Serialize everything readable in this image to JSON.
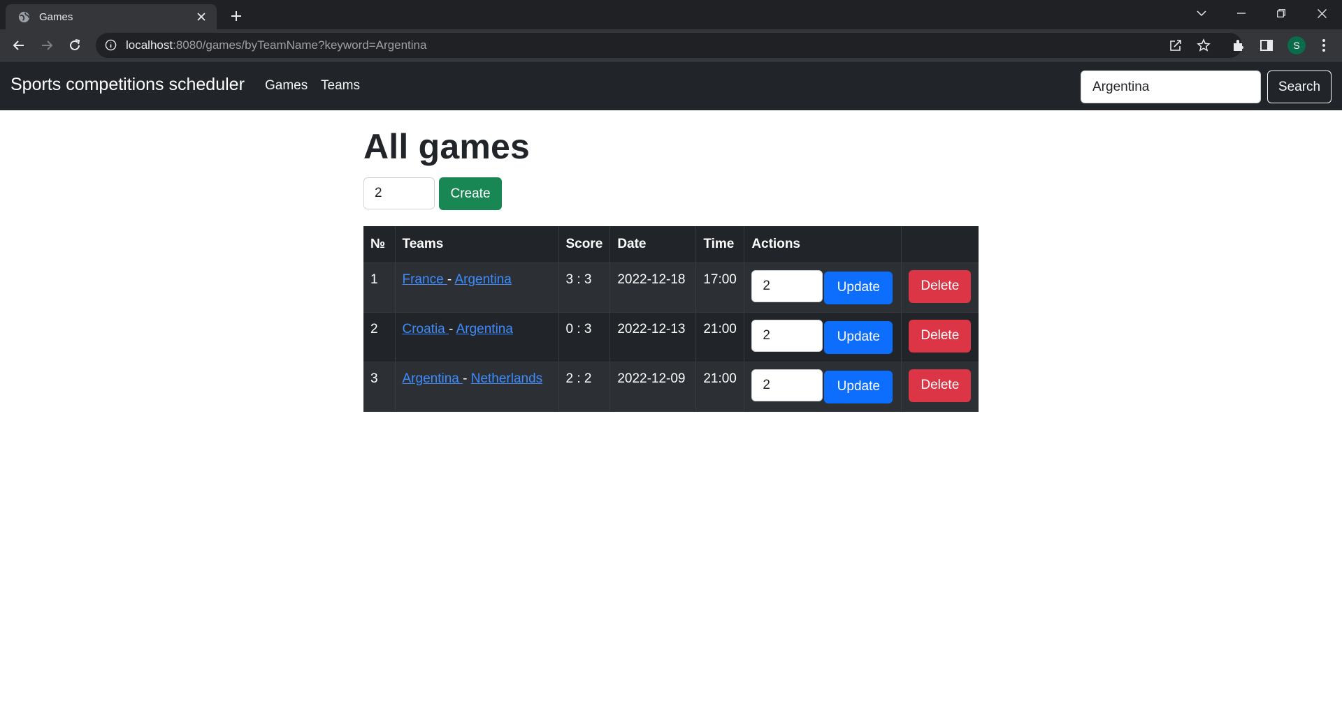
{
  "browser": {
    "tab_title": "Games",
    "url_host": "localhost",
    "url_rest": ":8080/games/byTeamName?keyword=Argentina",
    "profile_initial": "S"
  },
  "navbar": {
    "brand": "Sports competitions scheduler",
    "links": [
      "Games",
      "Teams"
    ],
    "search_value": "Argentina",
    "search_label": "Search"
  },
  "main": {
    "title": "All games",
    "create_value": "2",
    "create_label": "Create",
    "columns": [
      "№",
      "Teams",
      "Score",
      "Date",
      "Time",
      "Actions"
    ],
    "rows": [
      {
        "num": "1",
        "team1": "France ",
        "team2": "Argentina",
        "score": "3 : 3",
        "date": "2022-12-18",
        "time": "17:00",
        "input": "2",
        "update": "Update",
        "delete": "Delete"
      },
      {
        "num": "2",
        "team1": "Croatia ",
        "team2": "Argentina",
        "score": "0 : 3",
        "date": "2022-12-13",
        "time": "21:00",
        "input": "2",
        "update": "Update",
        "delete": "Delete"
      },
      {
        "num": "3",
        "team1": "Argentina ",
        "team2": "Netherlands",
        "score": "2 : 2",
        "date": "2022-12-09",
        "time": "21:00",
        "input": "2",
        "update": "Update",
        "delete": "Delete"
      }
    ],
    "team_separator": "-"
  }
}
